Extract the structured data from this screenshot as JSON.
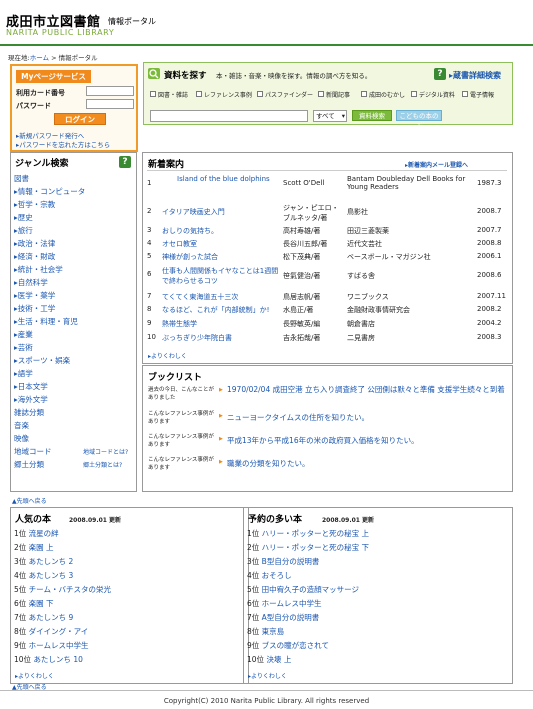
{
  "header": {
    "title": "成田市立図書館",
    "subtitle": "情報ポータル",
    "english": "NARITA PUBLIC LIBRARY"
  },
  "breadcrumb": {
    "prefix": "現在地:",
    "home": "ホーム",
    "sep": " > ",
    "current": "情報ポータル"
  },
  "login": {
    "title": "Myページサービス",
    "card_label": "利用カード番号",
    "password_label": "パスワード",
    "button": "ログイン",
    "link_new": "新規パスワード発行へ",
    "link_forgot": "パスワードを忘れた方はこちら"
  },
  "search": {
    "title": "資料を探す",
    "desc": "本・雑誌・音楽・映像を探す。情報の調べ方を知る。",
    "detail": "蔵書詳細検索",
    "checks": [
      "図書・雑誌",
      "レファレンス事例",
      "パスファインダー",
      "新聞記事",
      "成田のむかし",
      "デジタル資料",
      "電子情報"
    ],
    "select": "すべて",
    "button": "資料検索",
    "kids_button": "こどもの本のみ"
  },
  "genre": {
    "title": "ジャンル検索",
    "items": [
      "図書",
      "情報・コンピュータ",
      "哲学・宗教",
      "歴史",
      "旅行",
      "政治・法律",
      "経済・財政",
      "統計・社会学",
      "自然科学",
      "医学・薬学",
      "技術・工学",
      "生活・料理・育児",
      "産業",
      "芸術",
      "スポーツ・娯楽",
      "語学",
      "日本文学",
      "海外文学",
      "雑誌分類",
      "音楽",
      "映像",
      "地域コード",
      "郷土分類"
    ],
    "side": [
      "地域コードとは?",
      "郷土分類とは?"
    ]
  },
  "new_arrivals": {
    "title": "新着案内",
    "mail": "新着案内メール登録へ",
    "rows": [
      {
        "no": "1",
        "title": "Island of the blue dolphins",
        "author": "Scott O'Dell",
        "publisher": "Bantam Doubleday Dell Books for Young Readers",
        "year": "1987.3"
      },
      {
        "no": "2",
        "title": "イタリア映画史入門",
        "author": "ジャン・ピエロ・ブルネッタ/著",
        "publisher": "鳥影社",
        "year": "2008.7"
      },
      {
        "no": "3",
        "title": "おしりの気持ち。",
        "author": "高村寿雄/著",
        "publisher": "田辺三菱製薬",
        "year": "2007.7"
      },
      {
        "no": "4",
        "title": "オセロ教室",
        "author": "長谷川五郎/著",
        "publisher": "近代文芸社",
        "year": "2008.8"
      },
      {
        "no": "5",
        "title": "神様が創った試合",
        "author": "松下茂典/著",
        "publisher": "ベースボール・マガジン社",
        "year": "2006.1"
      },
      {
        "no": "6",
        "title": "仕事も人間関係もイヤなことは1週間で終わらせるコツ",
        "author": "笹氣健治/著",
        "publisher": "すばる舎",
        "year": "2008.6"
      },
      {
        "no": "7",
        "title": "てくてく東海道五十三次",
        "author": "鳥居志帆/著",
        "publisher": "ワニブックス",
        "year": "2007.11"
      },
      {
        "no": "8",
        "title": "なるほど、これが「内部統制」か!",
        "author": "水島正/著",
        "publisher": "金融財政事情研究会",
        "year": "2008.2"
      },
      {
        "no": "9",
        "title": "熱帯生態学",
        "author": "長野敏英/編",
        "publisher": "朝倉書店",
        "year": "2004.2"
      },
      {
        "no": "10",
        "title": "ぶっちぎり少年院白書",
        "author": "吉永拓哉/著",
        "publisher": "二見書房",
        "year": "2008.3"
      }
    ],
    "more": "よりくわしく"
  },
  "picks": {
    "title": "ブックリスト",
    "items": [
      {
        "label": "過去の今日、こんなことがありました",
        "text": "1970/02/04 成田空港 立ち入り調査終了 公団側は默々と準備 支援学生続々と到着"
      },
      {
        "label": "こんなレファレンス事例があります",
        "text": "ニューヨークタイムスの住所を知りたい。"
      },
      {
        "label": "こんなレファレンス事例があります",
        "text": "平成13年から平成16年の米の政府買入価格を知りたい。"
      },
      {
        "label": "こんなレファレンス事例があります",
        "text": "職業の分類を知りたい。"
      }
    ]
  },
  "back_top": "先頭へ戻る",
  "popular": {
    "title": "人気の本",
    "date": "2008.09.01 更新",
    "items": [
      {
        "rank": "1位",
        "title": "流星の絆"
      },
      {
        "rank": "2位",
        "title": "楽園 上"
      },
      {
        "rank": "3位",
        "title": "あたしンち 2"
      },
      {
        "rank": "4位",
        "title": "あたしンち 3"
      },
      {
        "rank": "5位",
        "title": "チーム・バチスタの栄光"
      },
      {
        "rank": "6位",
        "title": "楽園 下"
      },
      {
        "rank": "7位",
        "title": "あたしンち 9"
      },
      {
        "rank": "8位",
        "title": "ダイイング・アイ"
      },
      {
        "rank": "9位",
        "title": "ホームレス中学生"
      },
      {
        "rank": "10位",
        "title": "あたしンち 10"
      }
    ],
    "more": "よりくわしく"
  },
  "reserved": {
    "title": "予約の多い本",
    "date": "2008.09.01 更新",
    "items": [
      {
        "rank": "1位",
        "title": "ハリー・ポッターと死の秘宝 上"
      },
      {
        "rank": "2位",
        "title": "ハリー・ポッターと死の秘宝 下"
      },
      {
        "rank": "3位",
        "title": "B型自分の説明書"
      },
      {
        "rank": "4位",
        "title": "おそろし"
      },
      {
        "rank": "5位",
        "title": "田中宥久子の造顔マッサージ"
      },
      {
        "rank": "6位",
        "title": "ホームレス中学生"
      },
      {
        "rank": "7位",
        "title": "A型自分の説明書"
      },
      {
        "rank": "8位",
        "title": "東京島"
      },
      {
        "rank": "9位",
        "title": "ブスの瞳が恋されて"
      },
      {
        "rank": "10位",
        "title": "決壊 上"
      }
    ],
    "more": "よりくわしく"
  },
  "footer": "Copyright(C) 2010 Narita Public Library. All rights reserved"
}
